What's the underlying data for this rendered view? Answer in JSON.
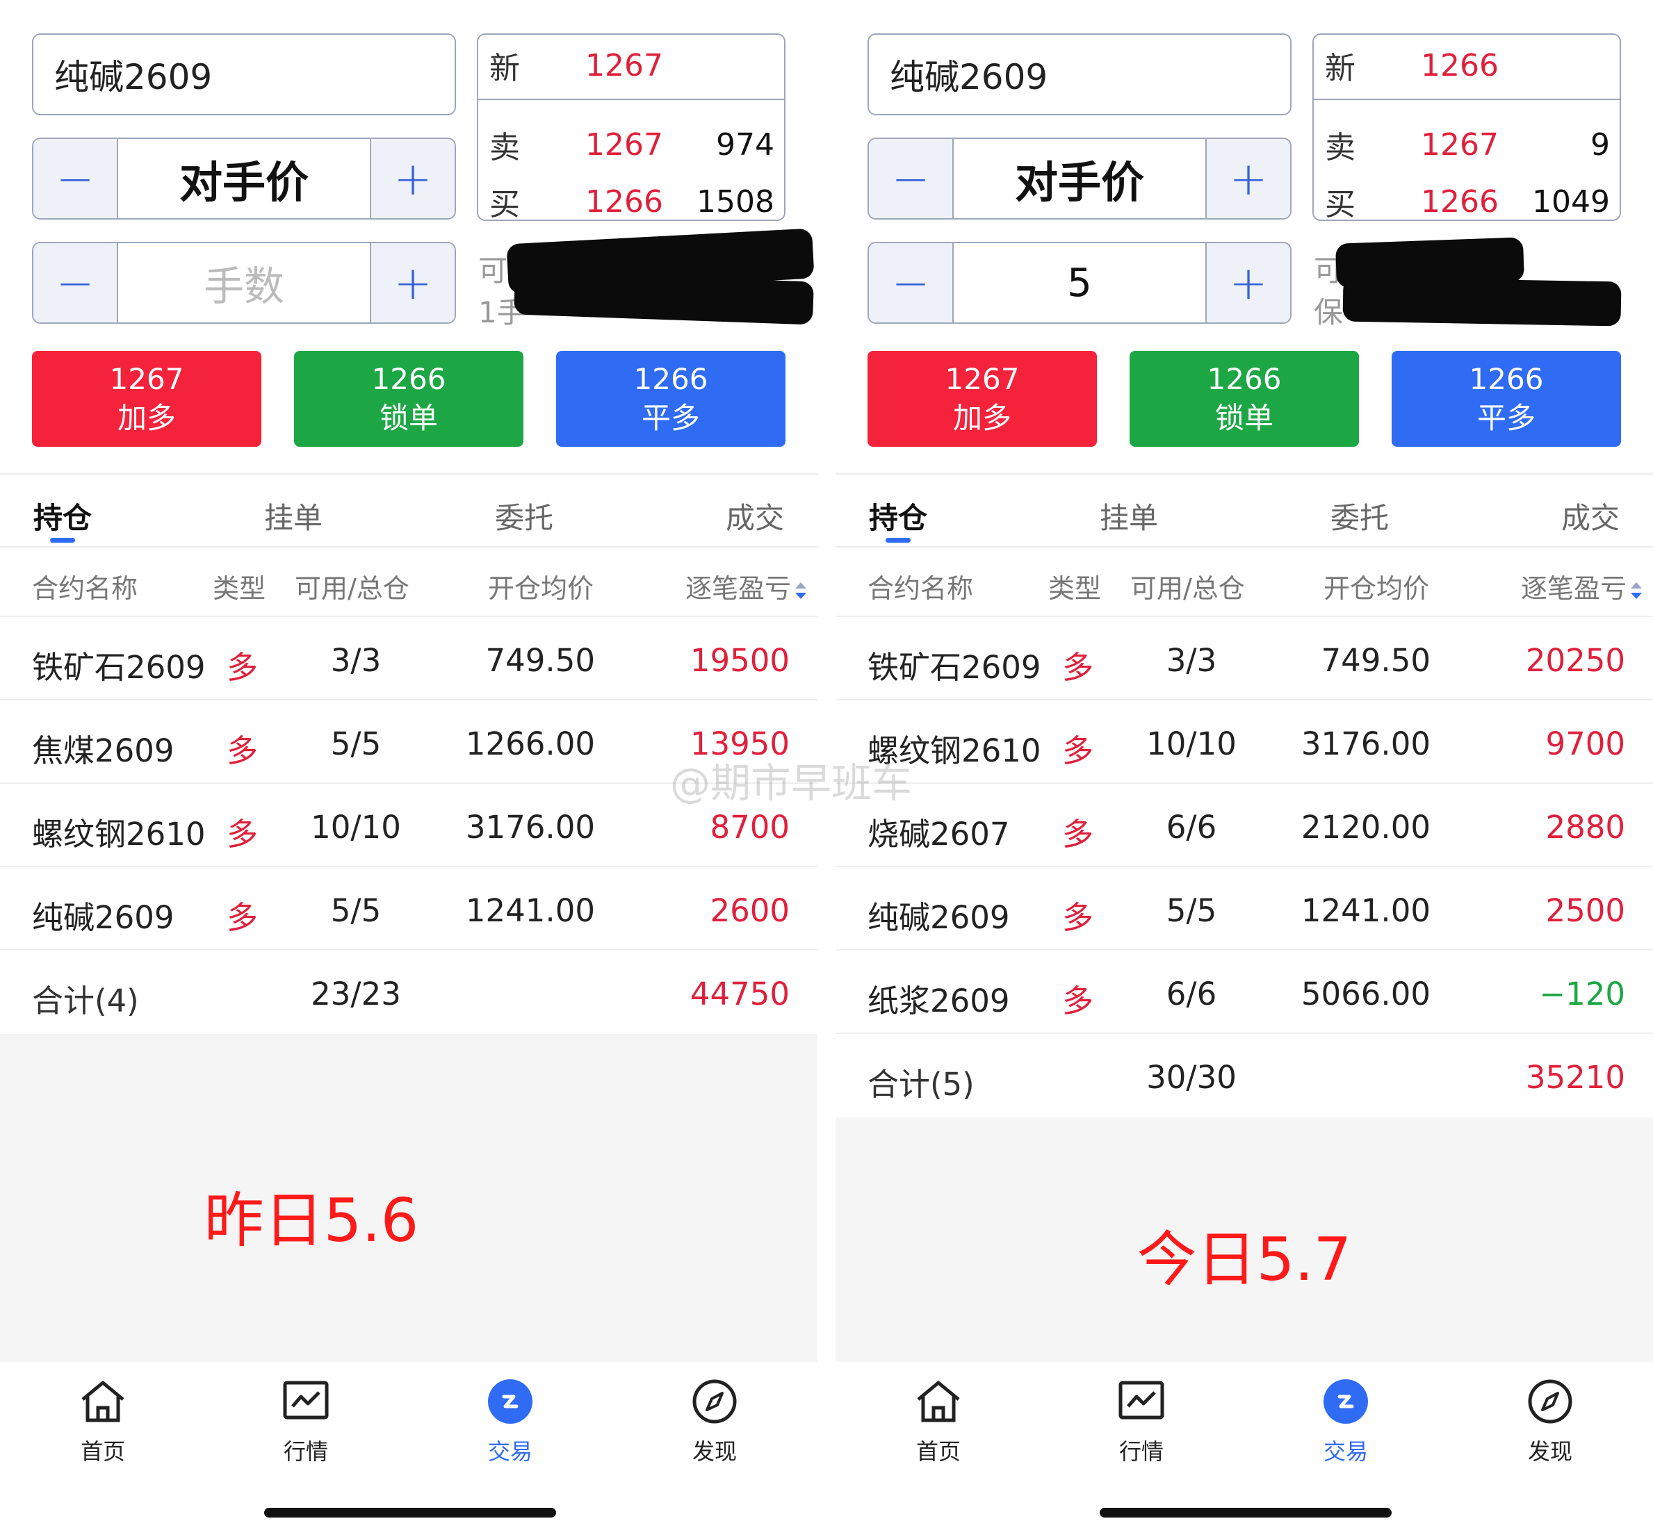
{
  "panels": [
    {
      "contract": "纯碱2609",
      "price_mode": "对手价",
      "quantity_placeholder": "手数",
      "quantity_value": "",
      "quote": {
        "last_label": "新",
        "last_price": "1267",
        "ask_label": "卖",
        "ask_price": "1267",
        "ask_volume": "974",
        "bid_label": "买",
        "bid_price": "1266",
        "bid_volume": "1508"
      },
      "info_peek_1": "可",
      "info_peek_2": "1手",
      "buttons": [
        {
          "price": "1267",
          "label": "加多"
        },
        {
          "price": "1266",
          "label": "锁单"
        },
        {
          "price": "1266",
          "label": "平多"
        }
      ],
      "tabs": [
        "持仓",
        "挂单",
        "委托",
        "成交"
      ],
      "headers": [
        "合约名称",
        "类型",
        "可用/总仓",
        "开仓均价",
        "逐笔盈亏"
      ],
      "rows": [
        {
          "name": "铁矿石2609",
          "type": "多",
          "pos": "3/3",
          "avg": "749.50",
          "pnl": "19500"
        },
        {
          "name": "焦煤2609",
          "type": "多",
          "pos": "5/5",
          "avg": "1266.00",
          "pnl": "13950"
        },
        {
          "name": "螺纹钢2610",
          "type": "多",
          "pos": "10/10",
          "avg": "3176.00",
          "pnl": "8700"
        },
        {
          "name": "纯碱2609",
          "type": "多",
          "pos": "5/5",
          "avg": "1241.00",
          "pnl": "2600"
        }
      ],
      "total": {
        "name": "合计(4)",
        "pos": "23/23",
        "pnl": "44750"
      },
      "caption": "昨日5.6",
      "nav": [
        "首页",
        "行情",
        "交易",
        "发现"
      ]
    },
    {
      "contract": "纯碱2609",
      "price_mode": "对手价",
      "quantity_placeholder": "",
      "quantity_value": "5",
      "quote": {
        "last_label": "新",
        "last_price": "1266",
        "ask_label": "卖",
        "ask_price": "1267",
        "ask_volume": "9",
        "bid_label": "买",
        "bid_price": "1266",
        "bid_volume": "1049"
      },
      "info_peek_1": "可",
      "info_peek_2": "保",
      "buttons": [
        {
          "price": "1267",
          "label": "加多"
        },
        {
          "price": "1266",
          "label": "锁单"
        },
        {
          "price": "1266",
          "label": "平多"
        }
      ],
      "tabs": [
        "持仓",
        "挂单",
        "委托",
        "成交"
      ],
      "headers": [
        "合约名称",
        "类型",
        "可用/总仓",
        "开仓均价",
        "逐笔盈亏"
      ],
      "rows": [
        {
          "name": "铁矿石2609",
          "type": "多",
          "pos": "3/3",
          "avg": "749.50",
          "pnl": "20250"
        },
        {
          "name": "螺纹钢2610",
          "type": "多",
          "pos": "10/10",
          "avg": "3176.00",
          "pnl": "9700"
        },
        {
          "name": "烧碱2607",
          "type": "多",
          "pos": "6/6",
          "avg": "2120.00",
          "pnl": "2880"
        },
        {
          "name": "纯碱2609",
          "type": "多",
          "pos": "5/5",
          "avg": "1241.00",
          "pnl": "2500"
        },
        {
          "name": "纸浆2609",
          "type": "多",
          "pos": "6/6",
          "avg": "5066.00",
          "pnl": "−120"
        }
      ],
      "total": {
        "name": "合计(5)",
        "pos": "30/30",
        "pnl": "35210"
      },
      "caption": "今日5.7",
      "nav": [
        "首页",
        "行情",
        "交易",
        "发现"
      ]
    }
  ],
  "watermark": "@期市早班车",
  "colors": {
    "accent": "#2f6bf3",
    "red": "#f5223b",
    "green": "#1ca744",
    "profit": "#e0203b",
    "loss": "#1ca744"
  }
}
